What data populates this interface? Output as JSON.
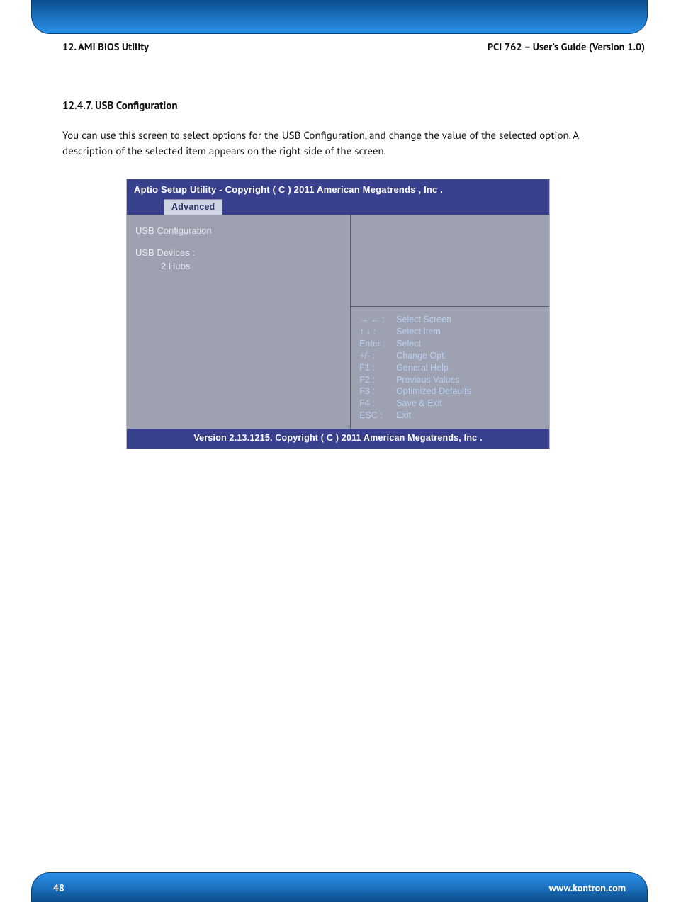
{
  "header": {
    "left": "12. AMI BIOS Utility",
    "right": "PCI 762 – User's Guide (Version 1.0)"
  },
  "section": {
    "number_title": "12.4.7. USB Configuration",
    "paragraph": "You can use this screen to select options for the USB Configuration, and change the value of the selected option. A description of the selected item appears on the right side of the screen."
  },
  "bios": {
    "title": "Aptio Setup Utility - Copyright ( C ) 2011 American Megatrends , Inc .",
    "tab": "Advanced",
    "left": {
      "heading": "USB Configuration",
      "devices_label": "USB Devices :",
      "devices_value": "2 Hubs"
    },
    "help": {
      "rows": [
        {
          "k": "→ ← :",
          "v": "Select Screen"
        },
        {
          "k": "↑ ↓   :",
          "v": "Select Item"
        },
        {
          "k": "Enter  :",
          "v": "Select"
        },
        {
          "k": "+/-  :",
          "v": "Change Opt."
        },
        {
          "k": "F1 :",
          "v": "General Help"
        },
        {
          "k": "F2 :",
          "v": "Previous Values"
        },
        {
          "k": "F3 :",
          "v": "Optimized Defaults"
        },
        {
          "k": "F4 :",
          "v": "Save & Exit"
        },
        {
          "k": "ESC :",
          "v": "Exit"
        }
      ]
    },
    "footer": "Version 2.13.1215. Copyright ( C ) 2011 American Megatrends, Inc ."
  },
  "footer": {
    "page": "48",
    "site": "www.kontron.com"
  }
}
